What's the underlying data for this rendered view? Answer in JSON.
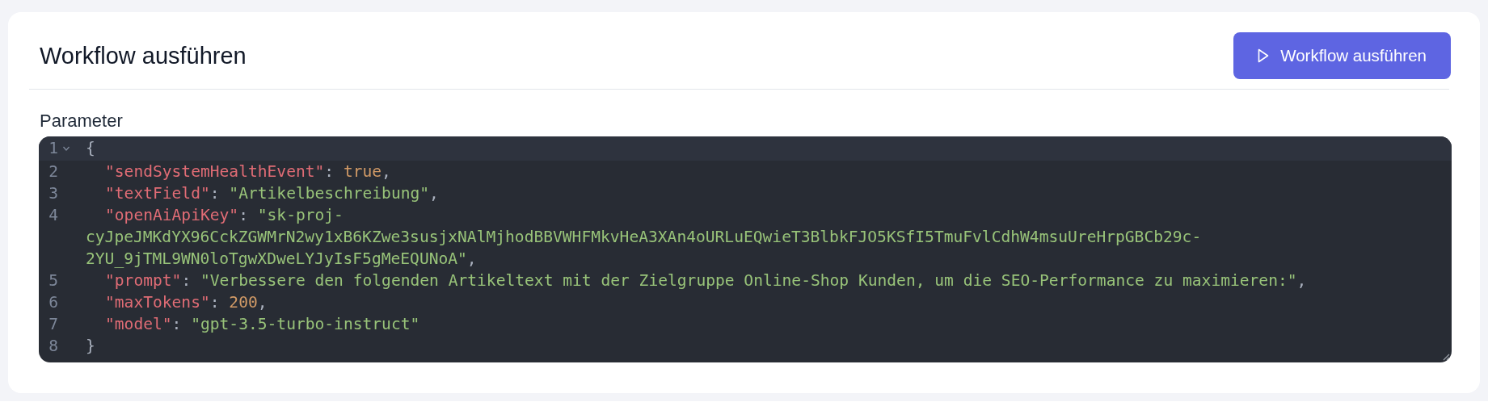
{
  "title": "Workflow ausführen",
  "run_button": {
    "label": "Workflow ausführen"
  },
  "parameter_label": "Parameter",
  "editor": {
    "rows": [
      {
        "number": "1",
        "active": true,
        "foldable": true,
        "tokens": [
          {
            "kind": "punct",
            "text": "{"
          }
        ]
      },
      {
        "number": "2",
        "active": false,
        "foldable": false,
        "tokens": [
          {
            "kind": "key",
            "text": "\"sendSystemHealthEvent\""
          },
          {
            "kind": "punct",
            "text": ": "
          },
          {
            "kind": "literal",
            "text": "true"
          },
          {
            "kind": "punct",
            "text": ","
          }
        ]
      },
      {
        "number": "3",
        "active": false,
        "foldable": false,
        "tokens": [
          {
            "kind": "key",
            "text": "\"textField\""
          },
          {
            "kind": "punct",
            "text": ": "
          },
          {
            "kind": "string",
            "text": "\"Artikelbeschreibung\""
          },
          {
            "kind": "punct",
            "text": ","
          }
        ]
      },
      {
        "number": "4",
        "active": false,
        "foldable": false,
        "tokens": [
          {
            "kind": "key",
            "text": "\"openAiApiKey\""
          },
          {
            "kind": "punct",
            "text": ": "
          },
          {
            "kind": "string",
            "text": "\"sk-proj-"
          }
        ]
      },
      {
        "active": false,
        "foldable": false,
        "tokens": [
          {
            "kind": "string",
            "text": "cyJpeJMKdYX96CckZGWMrN2wy1xB6KZwe3susjxNAlMjhodBBVWHFMkvHeA3XAn4oURLuEQwieT3BlbkFJO5KSfI5TmuFvlCdhW4msuUreHrpGBCb29c-"
          }
        ]
      },
      {
        "active": false,
        "foldable": false,
        "tokens": [
          {
            "kind": "string",
            "text": "2YU_9jTML9WN0loTgwXDweLYJyIsF5gMeEQUNoA\""
          },
          {
            "kind": "punct",
            "text": ","
          }
        ]
      },
      {
        "number": "5",
        "active": false,
        "foldable": false,
        "tokens": [
          {
            "kind": "key",
            "text": "\"prompt\""
          },
          {
            "kind": "punct",
            "text": ": "
          },
          {
            "kind": "string",
            "text": "\"Verbessere den folgenden Artikeltext mit der Zielgruppe Online-Shop Kunden, um die SEO-Performance zu maximieren:\""
          },
          {
            "kind": "punct",
            "text": ","
          }
        ]
      },
      {
        "number": "6",
        "active": false,
        "foldable": false,
        "tokens": [
          {
            "kind": "key",
            "text": "\"maxTokens\""
          },
          {
            "kind": "punct",
            "text": ": "
          },
          {
            "kind": "literal",
            "text": "200"
          },
          {
            "kind": "punct",
            "text": ","
          }
        ]
      },
      {
        "number": "7",
        "active": false,
        "foldable": false,
        "tokens": [
          {
            "kind": "key",
            "text": "\"model\""
          },
          {
            "kind": "punct",
            "text": ": "
          },
          {
            "kind": "string",
            "text": "\"gpt-3.5-turbo-instruct\""
          }
        ]
      },
      {
        "number": "8",
        "active": false,
        "foldable": false,
        "tokens": [
          {
            "kind": "punct",
            "text": "}"
          }
        ]
      }
    ]
  }
}
